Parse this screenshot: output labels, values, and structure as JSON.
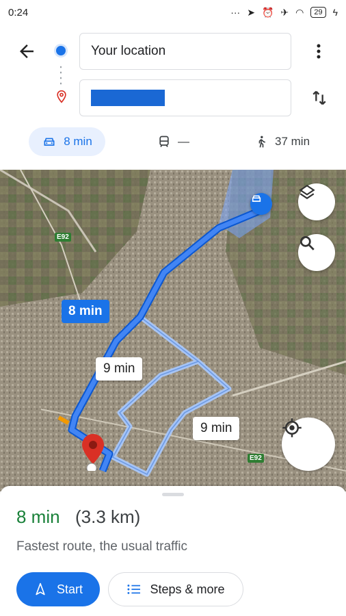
{
  "status_bar": {
    "time": "0:24",
    "icons": [
      "more-dots-icon",
      "location-arrow-icon",
      "alarm-icon",
      "airplane-icon",
      "wifi-icon"
    ],
    "battery": "29",
    "charging": true
  },
  "header": {
    "back_icon": "back-arrow-icon",
    "origin_value": "Your location",
    "destination_value": "",
    "more_icon": "more-vertical-icon",
    "swap_icon": "swap-icon"
  },
  "modes": [
    {
      "name": "driving",
      "icon": "car-icon",
      "value": "8 min",
      "selected": true
    },
    {
      "name": "transit",
      "icon": "train-icon",
      "value": "—",
      "selected": false
    },
    {
      "name": "walking",
      "icon": "walk-icon",
      "value": "37 min",
      "selected": false
    }
  ],
  "map": {
    "route_labels": {
      "main": "8 min",
      "alt1": "9 min",
      "alt2": "9 min"
    },
    "road_tags": [
      "E92",
      "E92"
    ],
    "layers_icon": "layers-icon",
    "search_icon": "search-icon",
    "locate_icon": "my-location-icon",
    "colors": {
      "route": "#1a73e8",
      "alt_route": "#a8c7fa",
      "destination_pin": "#d93025"
    }
  },
  "sheet": {
    "eta": "8 min",
    "distance": "(3.3 km)",
    "description": "Fastest route, the usual traffic",
    "start_label": "Start",
    "steps_label": "Steps & more"
  }
}
